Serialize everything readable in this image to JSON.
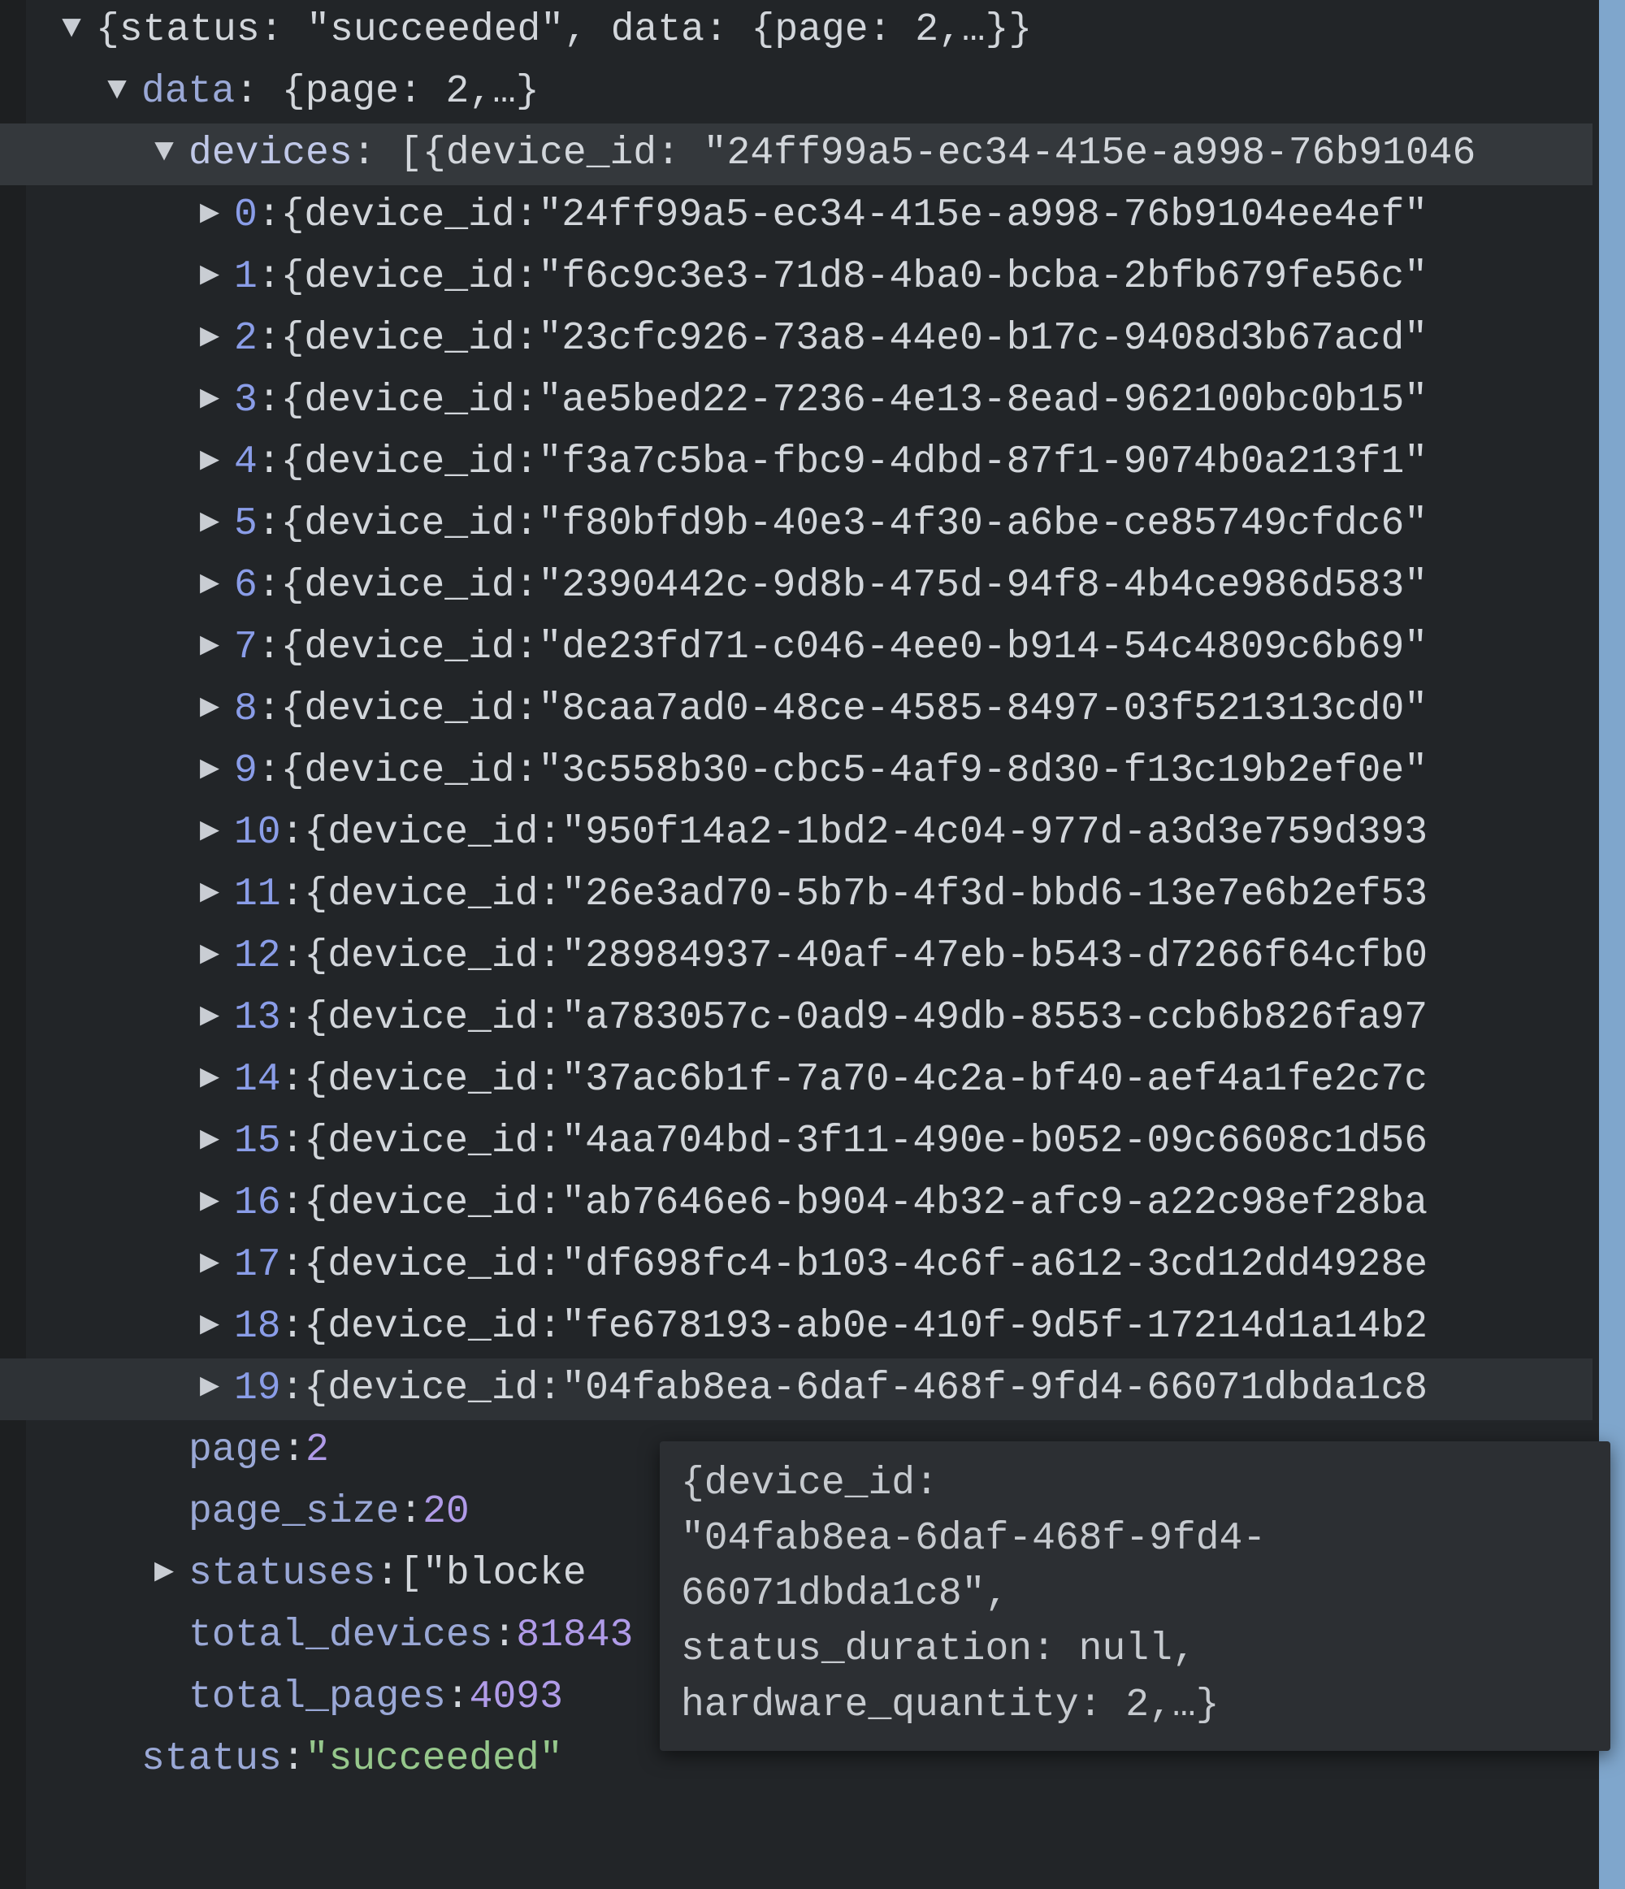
{
  "root": {
    "summary_prefix": "{status: ",
    "summary_status": "\"succeeded\"",
    "summary_mid": ", data: {page: ",
    "summary_page": "2",
    "summary_suffix": ",…}}"
  },
  "data_label": "data",
  "data_summary_prefix": ": {page: ",
  "data_summary_page": "2",
  "data_summary_suffix": ",…}",
  "devices_label": "devices",
  "devices_summary_prefix": ": [{device_id: ",
  "devices_summary_first": "\"24ff99a5-ec34-415e-a998-76b91046",
  "items": [
    {
      "idx": "0",
      "val": "\"24ff99a5-ec34-415e-a998-76b9104ee4ef\""
    },
    {
      "idx": "1",
      "val": "\"f6c9c3e3-71d8-4ba0-bcba-2bfb679fe56c\""
    },
    {
      "idx": "2",
      "val": "\"23cfc926-73a8-44e0-b17c-9408d3b67acd\""
    },
    {
      "idx": "3",
      "val": "\"ae5bed22-7236-4e13-8ead-962100bc0b15\""
    },
    {
      "idx": "4",
      "val": "\"f3a7c5ba-fbc9-4dbd-87f1-9074b0a213f1\""
    },
    {
      "idx": "5",
      "val": "\"f80bfd9b-40e3-4f30-a6be-ce85749cfdc6\""
    },
    {
      "idx": "6",
      "val": "\"2390442c-9d8b-475d-94f8-4b4ce986d583\""
    },
    {
      "idx": "7",
      "val": "\"de23fd71-c046-4ee0-b914-54c4809c6b69\""
    },
    {
      "idx": "8",
      "val": "\"8caa7ad0-48ce-4585-8497-03f521313cd0\""
    },
    {
      "idx": "9",
      "val": "\"3c558b30-cbc5-4af9-8d30-f13c19b2ef0e\""
    },
    {
      "idx": "10",
      "val": "\"950f14a2-1bd2-4c04-977d-a3d3e759d393"
    },
    {
      "idx": "11",
      "val": "\"26e3ad70-5b7b-4f3d-bbd6-13e7e6b2ef53"
    },
    {
      "idx": "12",
      "val": "\"28984937-40af-47eb-b543-d7266f64cfb0"
    },
    {
      "idx": "13",
      "val": "\"a783057c-0ad9-49db-8553-ccb6b826fa97"
    },
    {
      "idx": "14",
      "val": "\"37ac6b1f-7a70-4c2a-bf40-aef4a1fe2c7c"
    },
    {
      "idx": "15",
      "val": "\"4aa704bd-3f11-490e-b052-09c6608c1d56"
    },
    {
      "idx": "16",
      "val": "\"ab7646e6-b904-4b32-afc9-a22c98ef28ba"
    },
    {
      "idx": "17",
      "val": "\"df698fc4-b103-4c6f-a612-3cd12dd4928e"
    },
    {
      "idx": "18",
      "val": "\"fe678193-ab0e-410f-9d5f-17214d1a14b2"
    },
    {
      "idx": "19",
      "val": "\"04fab8ea-6daf-468f-9fd4-66071dbda1c8"
    }
  ],
  "item_prefix": "{device_id: ",
  "page_label": "page",
  "page_value": "2",
  "page_size_label": "page_size",
  "page_size_value": "20",
  "statuses_label": "statuses",
  "statuses_preview": "[\"blocke",
  "total_devices_label": "total_devices",
  "total_devices_value": "81843",
  "total_pages_label": "total_pages",
  "total_pages_value": "4093",
  "status_label": "status",
  "status_value": "\"succeeded\"",
  "tooltip": {
    "l1": "{device_id:",
    "l2": "\"04fab8ea-6daf-468f-9fd4-66071dbda1c8\",",
    "l3": "status_duration: null, hardware_quantity: 2,…}"
  }
}
